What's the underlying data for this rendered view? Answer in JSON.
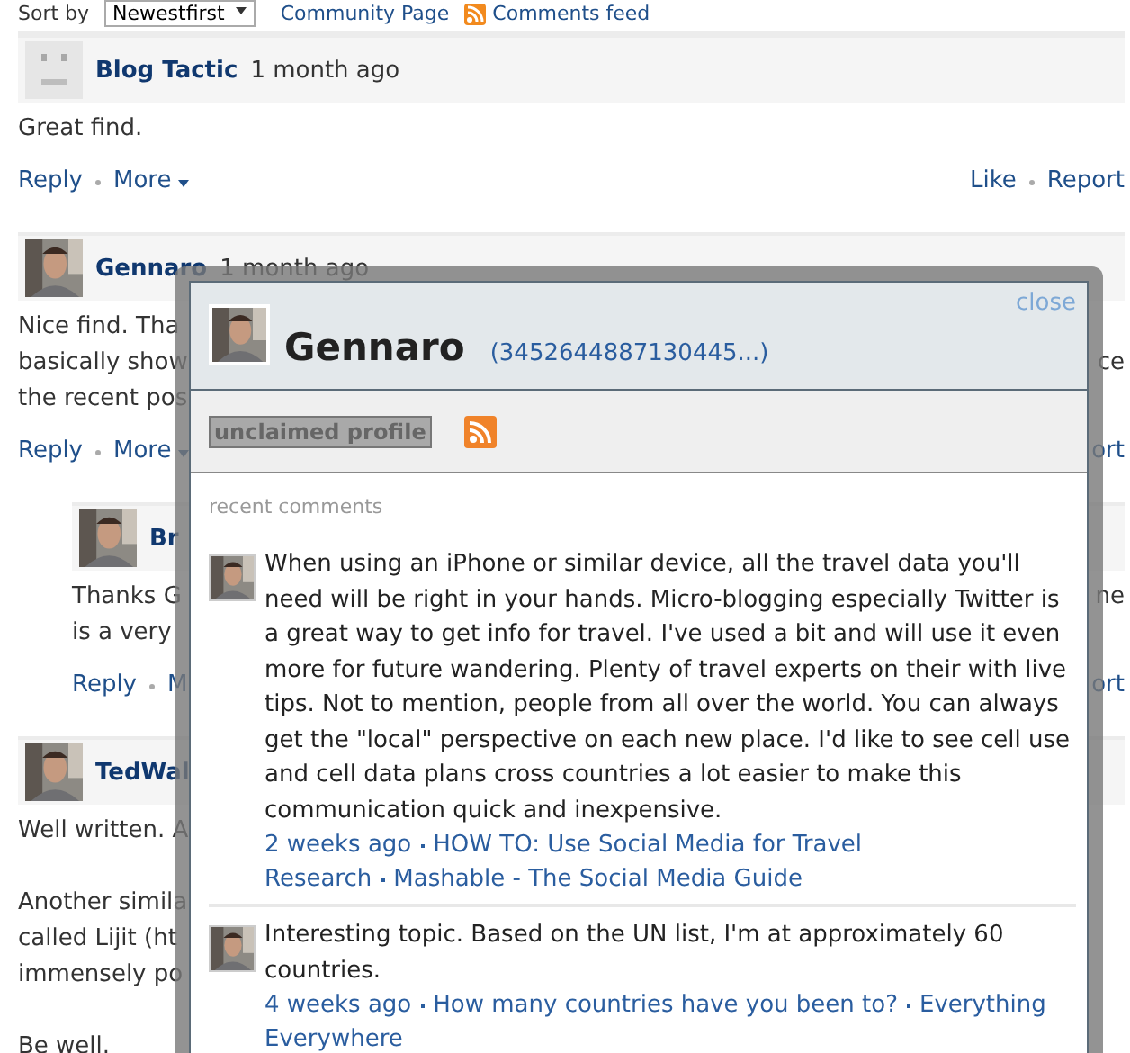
{
  "toolbar": {
    "sort_label": "Sort by",
    "sort_value": "Newestfirst",
    "community_link": "Community Page",
    "feed_link": "Comments feed"
  },
  "comments": [
    {
      "kind": "placeholder",
      "nested": false,
      "author": "Blog Tactic",
      "time": "1 month ago",
      "body": [
        [
          {
            "left": "Great find."
          }
        ]
      ],
      "actions": [
        "Reply",
        "More"
      ],
      "more_menu": true,
      "right_actions": [
        "Like",
        "Report"
      ]
    },
    {
      "nested": false,
      "author": "Gennaro",
      "time": "1 month ago",
      "body": [
        [
          {
            "left": "Nice find. Tha"
          },
          {
            "left": "basically show",
            "right": "ce"
          },
          {
            "left": "the recent pos"
          }
        ]
      ],
      "actions": [
        "Reply",
        "More"
      ],
      "more_menu": true,
      "right_actions": [
        "ort"
      ]
    },
    {
      "nested": true,
      "author": "Br",
      "body": [
        [
          {
            "left": "Thanks G",
            "right": "ne"
          },
          {
            "left": "is a very"
          }
        ]
      ],
      "actions": [
        "Reply",
        "M"
      ],
      "more_menu": false,
      "right_actions": [
        "ort"
      ]
    },
    {
      "nested": false,
      "author": "TedWal",
      "body": [
        [
          {
            "left": "Well written. A"
          }
        ],
        [
          {
            "left": "Another simila"
          },
          {
            "left": "called Lijit (ht"
          },
          {
            "left": "immensely po"
          }
        ],
        [
          {
            "left": "Be well."
          }
        ]
      ]
    }
  ],
  "profile_popup": {
    "close": "close",
    "name": "Gennaro",
    "id": "(3452644887130445...)",
    "badge": "unclaimed profile",
    "section_title": "recent comments",
    "recent_comments": [
      {
        "text": "When using an iPhone or similar device, all the travel data you'll need will be right in your hands. Micro-blogging especially Twitter is a great way to get info for travel. I've used a bit and will use it even more for future wandering. Plenty of travel experts on their with live tips. Not to mention, people from all over the world. You can always get the \"local\" perspective on each new place. I'd like to see cell use and cell data plans cross countries a lot easier to make this communication quick and inexpensive.",
        "link_lines": [
          [
            "2 weeks ago",
            "HOW TO: Use Social Media for Travel"
          ],
          [
            "Research",
            "Mashable - The Social Media Guide"
          ]
        ]
      },
      {
        "text": "Interesting topic. Based on the UN list, I'm at approximately 60 countries.",
        "link_lines": [
          [
            "4 weeks ago",
            "How many countries have you been to?",
            "Everything"
          ],
          [
            "Everywhere"
          ]
        ]
      }
    ]
  }
}
